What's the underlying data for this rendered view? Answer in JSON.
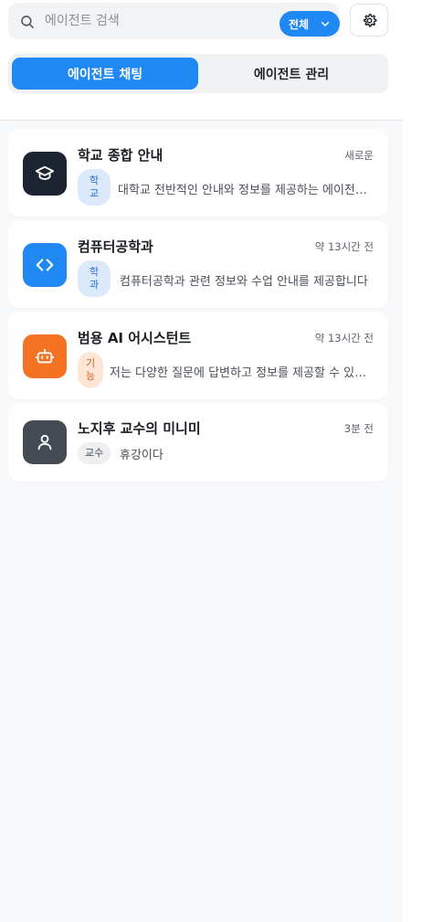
{
  "search": {
    "placeholder": "에이전트 검색",
    "value": "",
    "filter_label": "전체"
  },
  "tabs": [
    {
      "label": "에이전트 채팅",
      "active": true
    },
    {
      "label": "에이전트 관리",
      "active": false
    }
  ],
  "colors": {
    "accent": "#1f88f2"
  },
  "agents": [
    {
      "title": "학교 종합 안내",
      "time": "새로운",
      "badge": "학교",
      "description": "대학교 전반적인 안내와 정보를 제공하는 에이전트입니다",
      "icon": "graduation-cap-icon",
      "avatar_color": "#1c2431",
      "badge_bg": "#dbe9fb",
      "badge_fg": "#2a6fd1"
    },
    {
      "title": "컴퓨터공학과",
      "time": "약 13시간 전",
      "badge": "학과",
      "description": "컴퓨터공학과 관련 정보와 수업 안내를 제공합니다",
      "icon": "code-icon",
      "avatar_color": "#1f88f2",
      "badge_bg": "#dbe9fb",
      "badge_fg": "#2a6fd1"
    },
    {
      "title": "범용 AI 어시스턴트",
      "time": "약 13시간 전",
      "badge": "기능",
      "description": "저는 다양한 질문에 답변하고 정보를 제공할 수 있습니다",
      "icon": "robot-icon",
      "avatar_color": "#f47322",
      "badge_bg": "#fde6d6",
      "badge_fg": "#d2611c"
    },
    {
      "title": "노지후 교수의 미니미",
      "time": "3분 전",
      "badge": "교수",
      "description": "휴강이다",
      "icon": "user-icon",
      "avatar_color": "#454b55",
      "badge_bg": "#eeeff1",
      "badge_fg": "#3f444b"
    }
  ]
}
